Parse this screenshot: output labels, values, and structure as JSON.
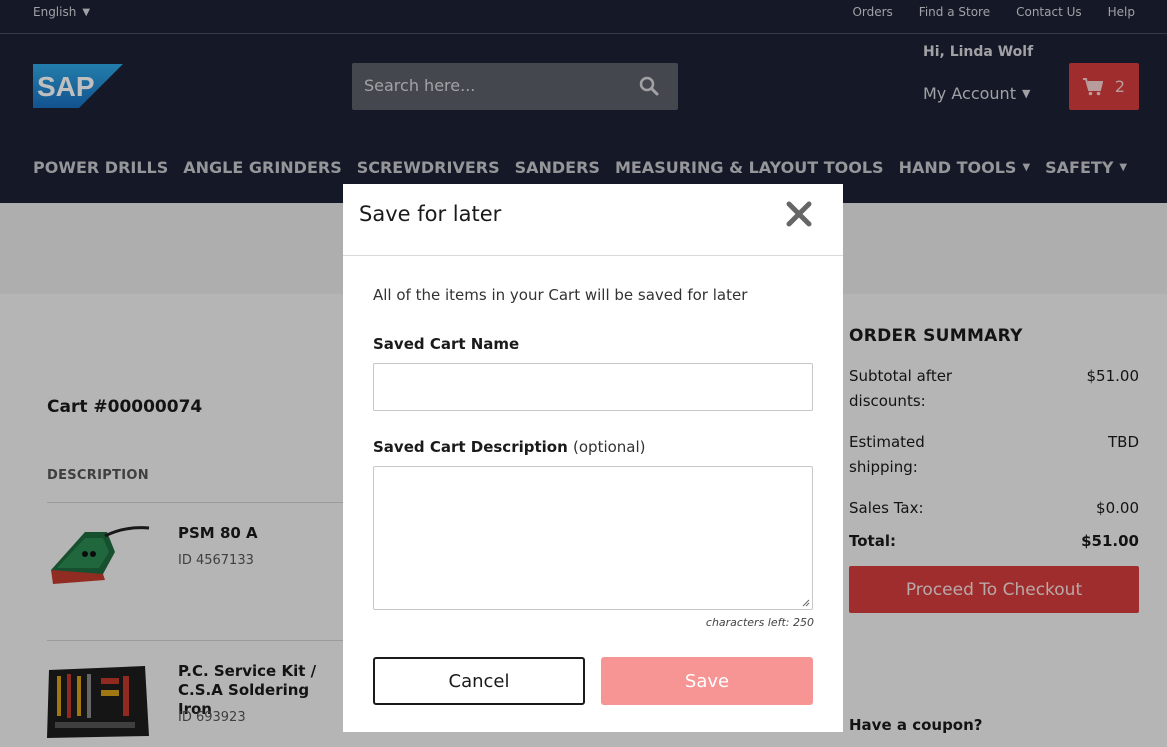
{
  "utility": {
    "language": "English",
    "links": [
      "Orders",
      "Find a Store",
      "Contact Us",
      "Help"
    ]
  },
  "header": {
    "logo_text": "SAP",
    "search_placeholder": "Search here...",
    "greeting": "Hi, Linda Wolf",
    "account_label": "My Account",
    "cart_count": "2",
    "nav": [
      "POWER DRILLS",
      "ANGLE GRINDERS",
      "SCREWDRIVERS",
      "SANDERS",
      "MEASURING & LAYOUT TOOLS",
      "HAND TOOLS",
      "SAFETY"
    ]
  },
  "cart": {
    "title": "Cart #00000074",
    "description_header": "DESCRIPTION",
    "items": [
      {
        "name": "PSM 80 A",
        "id": "ID 4567133"
      },
      {
        "name": "P.C. Service Kit / C.S.A Soldering Iron",
        "id": "ID 693923"
      }
    ]
  },
  "summary": {
    "title": "ORDER SUMMARY",
    "rows": [
      {
        "label": "Subtotal after discounts:",
        "value": "$51.00"
      },
      {
        "label": "Estimated shipping:",
        "value": "TBD"
      },
      {
        "label": "Sales Tax:",
        "value": "$0.00"
      },
      {
        "label": "Total:",
        "value": "$51.00"
      }
    ],
    "checkout_label": "Proceed To Checkout",
    "coupon_label": "Have a coupon?"
  },
  "modal": {
    "title": "Save for later",
    "message": "All of the items in your Cart will be saved for later",
    "name_label": "Saved Cart Name",
    "name_value": "",
    "description_label": "Saved Cart Description",
    "description_optional": "(optional)",
    "description_value": "",
    "chars_left": "characters left: 250",
    "cancel_label": "Cancel",
    "save_label": "Save"
  },
  "colors": {
    "header_bg": "#1c2033",
    "accent_red": "#d63c3c",
    "save_disabled": "#f79595"
  },
  "icons": {
    "search": "search-icon",
    "cart": "cart-icon",
    "close": "close-icon",
    "chevron": "chevron-down-icon"
  }
}
